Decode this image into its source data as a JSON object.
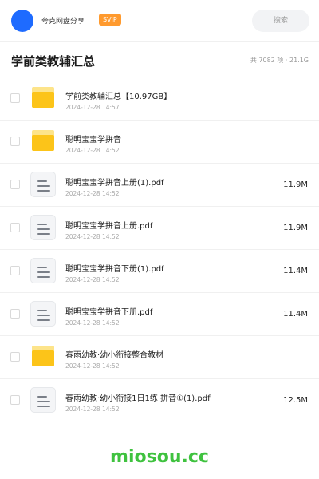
{
  "topbar": {
    "app_name": "夸克网盘分享",
    "badge": "SVIP",
    "search_label": "搜索",
    "accent": "#1e6bff",
    "badge_color": "#ff9a2e"
  },
  "header": {
    "title": "学前类教辅汇总",
    "stats": "共 7082 项 · 21.1G"
  },
  "files": [
    {
      "type": "folder",
      "icon": "folder-icon",
      "name": "学前类教辅汇总【10.97GB】",
      "date": "2024-12-28 14:57",
      "size": ""
    },
    {
      "type": "folder",
      "icon": "folder-icon",
      "name": "聪明宝宝学拼音",
      "date": "2024-12-28 14:52",
      "size": ""
    },
    {
      "type": "file",
      "icon": "document-icon",
      "name": "聪明宝宝学拼音上册(1).pdf",
      "date": "2024-12-28 14:52",
      "size": "11.9M"
    },
    {
      "type": "file",
      "icon": "document-icon",
      "name": "聪明宝宝学拼音上册.pdf",
      "date": "2024-12-28 14:52",
      "size": "11.9M"
    },
    {
      "type": "file",
      "icon": "document-icon",
      "name": "聪明宝宝学拼音下册(1).pdf",
      "date": "2024-12-28 14:52",
      "size": "11.4M"
    },
    {
      "type": "file",
      "icon": "document-icon",
      "name": "聪明宝宝学拼音下册.pdf",
      "date": "2024-12-28 14:52",
      "size": "11.4M"
    },
    {
      "type": "folder",
      "icon": "folder-icon",
      "name": "春雨幼教·幼小衔接整合教材",
      "date": "2024-12-28 14:52",
      "size": ""
    },
    {
      "type": "file",
      "icon": "document-icon",
      "name": "春雨幼教·幼小衔接1日1练 拼音①(1).pdf",
      "date": "2024-12-28 14:52",
      "size": "12.5M"
    }
  ],
  "watermark": "miosou.cc"
}
